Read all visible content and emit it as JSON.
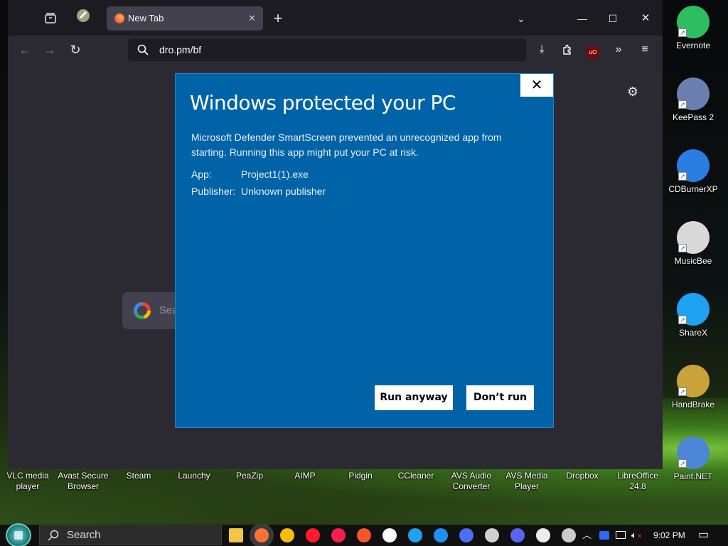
{
  "browser": {
    "tab_title": "New Tab",
    "url": "dro.pm/bf",
    "search_placeholder": "Sea"
  },
  "dialog": {
    "title": "Windows protected your PC",
    "message": "Microsoft Defender SmartScreen prevented an unrecognized app from starting. Running this app might put your PC at risk.",
    "app_label": "App:",
    "app_value": "Project1(1).exe",
    "publisher_label": "Publisher:",
    "publisher_value": "Unknown publisher",
    "run_anyway": "Run anyway",
    "dont_run": "Don’t run",
    "close_glyph": "✕"
  },
  "desktop_right_icons": [
    {
      "label": "Evernote",
      "color": "#2dbe60"
    },
    {
      "label": "KeePass 2",
      "color": "#6b7fb0"
    },
    {
      "label": "CDBurnerXP",
      "color": "#2a7de1"
    },
    {
      "label": "MusicBee",
      "color": "#d9d9d9"
    },
    {
      "label": "ShareX",
      "color": "#1fa2f2"
    },
    {
      "label": "HandBrake",
      "color": "#c9a23a"
    },
    {
      "label": "Paint.NET",
      "color": "#4a87d6"
    }
  ],
  "desktop_bottom_icons": [
    {
      "line1": "VLC media",
      "line2": "player",
      "color": "#f08c00"
    },
    {
      "line1": "Avast Secure",
      "line2": "Browser",
      "color": "#1a73e8"
    },
    {
      "line1": "Steam",
      "line2": "",
      "color": "#2a475e"
    },
    {
      "line1": "Launchy",
      "line2": "",
      "color": "#888888"
    },
    {
      "line1": "PeaZip",
      "line2": "",
      "color": "#9ac53c"
    },
    {
      "line1": "AIMP",
      "line2": "",
      "color": "#f2a000"
    },
    {
      "line1": "Pidgin",
      "line2": "",
      "color": "#7b5ea7"
    },
    {
      "line1": "CCleaner",
      "line2": "",
      "color": "#c0392b"
    },
    {
      "line1": "AVS Audio",
      "line2": "Converter",
      "color": "#2e86c1"
    },
    {
      "line1": "AVS Media",
      "line2": "Player",
      "color": "#2e86c1"
    },
    {
      "line1": "Dropbox",
      "line2": "",
      "color": "#0061fe"
    },
    {
      "line1": "LibreOffice",
      "line2": "24.8",
      "color": "#18a303"
    }
  ],
  "taskbar": {
    "search_label": "Search",
    "time": "9:02 PM",
    "apps": [
      {
        "name": "file-explorer",
        "color": "#f4c542"
      },
      {
        "name": "firefox",
        "color": "#ff7139"
      },
      {
        "name": "chrome",
        "color": "#fbbc04"
      },
      {
        "name": "opera",
        "color": "#ff1b2d"
      },
      {
        "name": "opera-gx",
        "color": "#fa1e4e"
      },
      {
        "name": "brave",
        "color": "#fb542b"
      },
      {
        "name": "yandex",
        "color": "#ffffff"
      },
      {
        "name": "edge",
        "color": "#1fa2f2"
      },
      {
        "name": "ccleaner",
        "color": "#1e90ff"
      },
      {
        "name": "vlc",
        "color": "#4c6ef5"
      },
      {
        "name": "remote-desktop",
        "color": "#cfcfcf"
      },
      {
        "name": "discord",
        "color": "#5865f2"
      },
      {
        "name": "7zip",
        "color": "#eeeeee"
      },
      {
        "name": "notepad",
        "color": "#cccccc"
      }
    ]
  }
}
